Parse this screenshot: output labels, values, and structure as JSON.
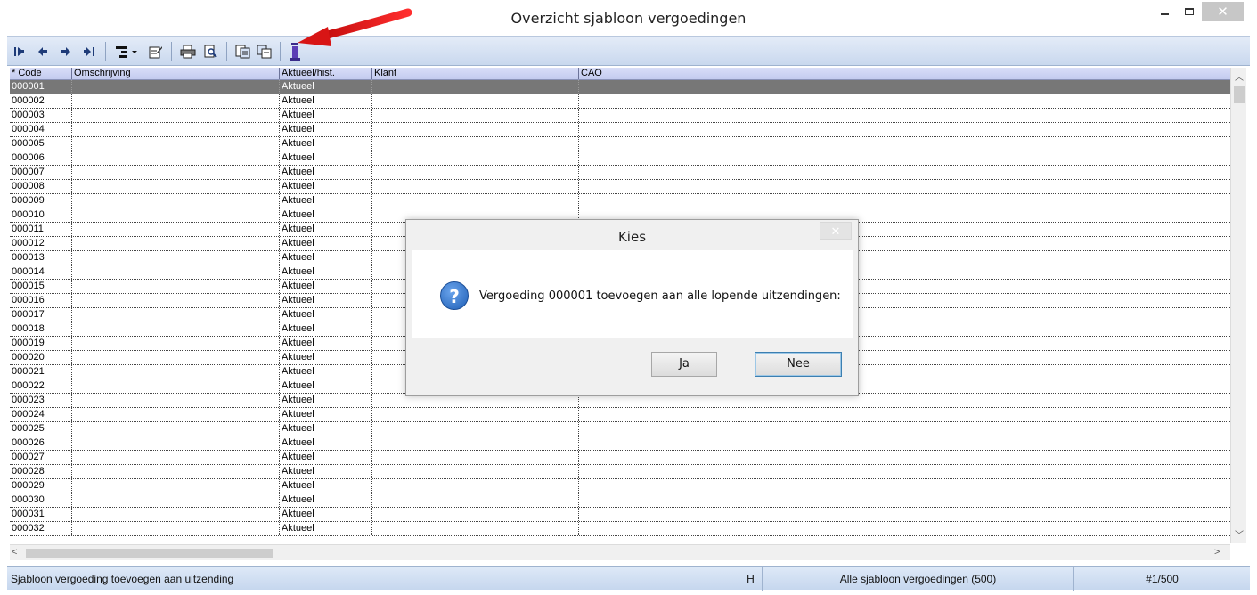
{
  "window": {
    "title": "Overzicht sjabloon vergoedingen"
  },
  "toolbar": {
    "icons": [
      "first-record-icon",
      "previous-record-icon",
      "next-record-icon",
      "last-record-icon",
      "view-menu-icon",
      "edit-icon",
      "print-icon",
      "print-preview-icon",
      "add-to-assignment-icon",
      "copy-icon",
      "info-icon"
    ]
  },
  "grid": {
    "columns": [
      "* Code",
      "Omschrijving",
      "Aktueel/hist.",
      "Klant",
      "CAO"
    ],
    "rows": [
      {
        "code": "000001",
        "omschrijving": "",
        "status": "Aktueel",
        "klant": "",
        "cao": ""
      },
      {
        "code": "000002",
        "omschrijving": "",
        "status": "Aktueel",
        "klant": "",
        "cao": ""
      },
      {
        "code": "000003",
        "omschrijving": "",
        "status": "Aktueel",
        "klant": "",
        "cao": ""
      },
      {
        "code": "000004",
        "omschrijving": "",
        "status": "Aktueel",
        "klant": "",
        "cao": ""
      },
      {
        "code": "000005",
        "omschrijving": "",
        "status": "Aktueel",
        "klant": "",
        "cao": ""
      },
      {
        "code": "000006",
        "omschrijving": "",
        "status": "Aktueel",
        "klant": "",
        "cao": ""
      },
      {
        "code": "000007",
        "omschrijving": "",
        "status": "Aktueel",
        "klant": "",
        "cao": ""
      },
      {
        "code": "000008",
        "omschrijving": "",
        "status": "Aktueel",
        "klant": "",
        "cao": ""
      },
      {
        "code": "000009",
        "omschrijving": "",
        "status": "Aktueel",
        "klant": "",
        "cao": ""
      },
      {
        "code": "000010",
        "omschrijving": "",
        "status": "Aktueel",
        "klant": "",
        "cao": ""
      },
      {
        "code": "000011",
        "omschrijving": "",
        "status": "Aktueel",
        "klant": "",
        "cao": ""
      },
      {
        "code": "000012",
        "omschrijving": "",
        "status": "Aktueel",
        "klant": "",
        "cao": ""
      },
      {
        "code": "000013",
        "omschrijving": "",
        "status": "Aktueel",
        "klant": "",
        "cao": ""
      },
      {
        "code": "000014",
        "omschrijving": "",
        "status": "Aktueel",
        "klant": "",
        "cao": ""
      },
      {
        "code": "000015",
        "omschrijving": "",
        "status": "Aktueel",
        "klant": "",
        "cao": ""
      },
      {
        "code": "000016",
        "omschrijving": "",
        "status": "Aktueel",
        "klant": "",
        "cao": ""
      },
      {
        "code": "000017",
        "omschrijving": "",
        "status": "Aktueel",
        "klant": "",
        "cao": ""
      },
      {
        "code": "000018",
        "omschrijving": "",
        "status": "Aktueel",
        "klant": "",
        "cao": ""
      },
      {
        "code": "000019",
        "omschrijving": "",
        "status": "Aktueel",
        "klant": "",
        "cao": ""
      },
      {
        "code": "000020",
        "omschrijving": "",
        "status": "Aktueel",
        "klant": "",
        "cao": ""
      },
      {
        "code": "000021",
        "omschrijving": "",
        "status": "Aktueel",
        "klant": "",
        "cao": ""
      },
      {
        "code": "000022",
        "omschrijving": "",
        "status": "Aktueel",
        "klant": "",
        "cao": ""
      },
      {
        "code": "000023",
        "omschrijving": "",
        "status": "Aktueel",
        "klant": "",
        "cao": ""
      },
      {
        "code": "000024",
        "omschrijving": "",
        "status": "Aktueel",
        "klant": "",
        "cao": ""
      },
      {
        "code": "000025",
        "omschrijving": "",
        "status": "Aktueel",
        "klant": "",
        "cao": ""
      },
      {
        "code": "000026",
        "omschrijving": "",
        "status": "Aktueel",
        "klant": "",
        "cao": ""
      },
      {
        "code": "000027",
        "omschrijving": "",
        "status": "Aktueel",
        "klant": "",
        "cao": ""
      },
      {
        "code": "000028",
        "omschrijving": "",
        "status": "Aktueel",
        "klant": "",
        "cao": ""
      },
      {
        "code": "000029",
        "omschrijving": "",
        "status": "Aktueel",
        "klant": "",
        "cao": ""
      },
      {
        "code": "000030",
        "omschrijving": "",
        "status": "Aktueel",
        "klant": "",
        "cao": ""
      },
      {
        "code": "000031",
        "omschrijving": "",
        "status": "Aktueel",
        "klant": "",
        "cao": ""
      },
      {
        "code": "000032",
        "omschrijving": "",
        "status": "Aktueel",
        "klant": "",
        "cao": ""
      }
    ],
    "selected_index": 0
  },
  "statusbar": {
    "hint": "Sjabloon vergoeding toevoegen aan uitzending",
    "mode": "H",
    "filter": "Alle sjabloon vergoedingen (500)",
    "position": "#1/500"
  },
  "dialog": {
    "title": "Kies",
    "message": "Vergoeding 000001 toevoegen aan alle lopende uitzendingen:",
    "yes_label": "Ja",
    "no_label": "Nee",
    "close_label": "✕",
    "icon": "question-icon",
    "icon_glyph": "?"
  },
  "colors": {
    "selected_row": "#777777",
    "toolbar_accent": "#1e3b78",
    "annotation_arrow": "#e11a1a"
  }
}
